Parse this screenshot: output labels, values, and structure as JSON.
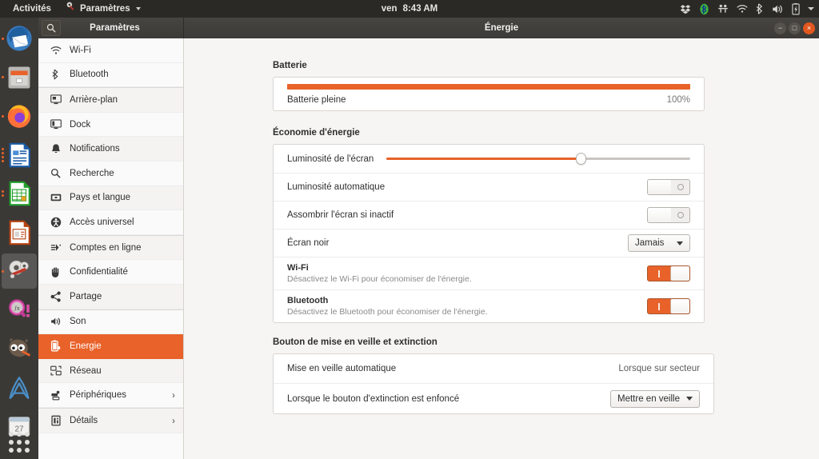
{
  "topbar": {
    "activities": "Activités",
    "app_menu": "Paramètres",
    "day": "ven",
    "time": "8:43 AM",
    "tray_icons": [
      "dropbox-icon",
      "bluetooth-active-icon",
      "remote-desktop-icon",
      "wifi-icon",
      "bluetooth-icon",
      "volume-icon",
      "battery-icon",
      "system-menu-caret-icon"
    ]
  },
  "dock": {
    "items": [
      {
        "name": "thunderbird",
        "running": true
      },
      {
        "name": "files",
        "running": true
      },
      {
        "name": "firefox",
        "running": true
      },
      {
        "name": "libreoffice-writer",
        "running": true
      },
      {
        "name": "libreoffice-calc",
        "running": true
      },
      {
        "name": "libreoffice-impress",
        "running": false
      },
      {
        "name": "settings",
        "running": true,
        "active": true
      },
      {
        "name": "mathematics",
        "running": false
      },
      {
        "name": "gimp",
        "running": false
      },
      {
        "name": "ardour",
        "running": false
      },
      {
        "name": "calendar",
        "running": false,
        "badge": "27"
      }
    ],
    "show_apps_label": "show-applications"
  },
  "window": {
    "sidebar_title": "Paramètres",
    "title": "Énergie",
    "search_icon": "search-icon",
    "controls": {
      "minimize": "−",
      "maximize": "□",
      "close": "×"
    }
  },
  "sidebar": {
    "items": [
      {
        "label": "Wi-Fi",
        "icon": "wifi-icon",
        "selected": false,
        "chevron": false
      },
      {
        "label": "Bluetooth",
        "icon": "bluetooth-icon",
        "selected": false,
        "chevron": false
      },
      {
        "label": "Arrière-plan",
        "icon": "background-icon",
        "selected": false,
        "chevron": false
      },
      {
        "label": "Dock",
        "icon": "dock-icon",
        "selected": false,
        "chevron": false
      },
      {
        "label": "Notifications",
        "icon": "bell-icon",
        "selected": false,
        "chevron": false
      },
      {
        "label": "Recherche",
        "icon": "search-icon",
        "selected": false,
        "chevron": false
      },
      {
        "label": "Pays et langue",
        "icon": "region-language-icon",
        "selected": false,
        "chevron": false
      },
      {
        "label": "Accès universel",
        "icon": "accessibility-icon",
        "selected": false,
        "chevron": false
      },
      {
        "label": "Comptes en ligne",
        "icon": "online-accounts-icon",
        "selected": false,
        "chevron": false
      },
      {
        "label": "Confidentialité",
        "icon": "privacy-hand-icon",
        "selected": false,
        "chevron": false
      },
      {
        "label": "Partage",
        "icon": "share-icon",
        "selected": false,
        "chevron": false
      },
      {
        "label": "Son",
        "icon": "sound-icon",
        "selected": false,
        "chevron": false
      },
      {
        "label": "Énergie",
        "icon": "power-icon",
        "selected": true,
        "chevron": false
      },
      {
        "label": "Réseau",
        "icon": "network-icon",
        "selected": false,
        "chevron": false
      },
      {
        "label": "Périphériques",
        "icon": "devices-icon",
        "selected": false,
        "chevron": true
      },
      {
        "label": "Détails",
        "icon": "details-icon",
        "selected": false,
        "chevron": true
      }
    ],
    "chevron_glyph": "›"
  },
  "content": {
    "battery": {
      "title": "Batterie",
      "status": "Batterie pleine",
      "percent_label": "100%",
      "percent_value": 100
    },
    "power_saving": {
      "title": "Économie d'énergie",
      "brightness": {
        "label": "Luminosité de l'écran",
        "value": 64
      },
      "auto_brightness": {
        "label": "Luminosité automatique",
        "state": "off"
      },
      "dim_screen": {
        "label": "Assombrir l'écran si inactif",
        "state": "off"
      },
      "blank_screen": {
        "label": "Écran noir",
        "value": "Jamais"
      },
      "wifi": {
        "label": "Wi-Fi",
        "sub": "Désactivez le Wi-Fi pour économiser de l'énergie.",
        "state": "on"
      },
      "bluetooth": {
        "label": "Bluetooth",
        "sub": "Désactivez le Bluetooth pour économiser de l'énergie.",
        "state": "on"
      }
    },
    "suspend": {
      "title": "Bouton de mise en veille et extinction",
      "auto_suspend": {
        "label": "Mise en veille automatique",
        "value": "Lorsque sur secteur"
      },
      "power_button": {
        "label": "Lorsque le bouton d'extinction est enfoncé",
        "value": "Mettre en veille"
      }
    }
  },
  "colors": {
    "accent": "#e8622a",
    "topbar_bg": "#2b2926",
    "dock_bg": "#3b3936",
    "content_bg": "#f6f5f4",
    "card_bg": "#ffffff"
  }
}
